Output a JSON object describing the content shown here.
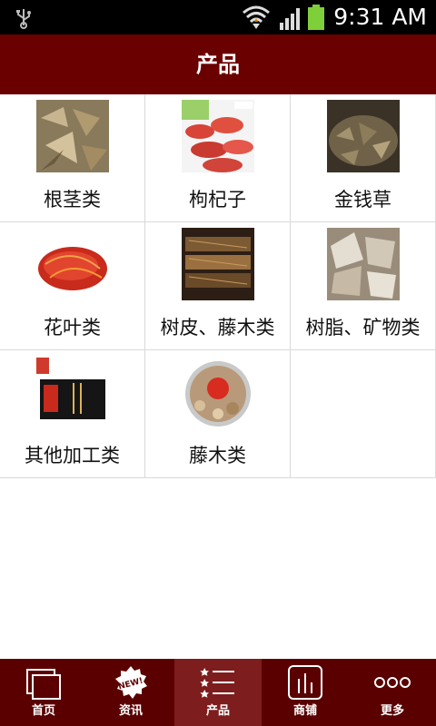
{
  "status_bar": {
    "time": "9:31 AM"
  },
  "header": {
    "title": "产品"
  },
  "categories": [
    {
      "label": "根茎类",
      "icon": "dried-root-slices-image"
    },
    {
      "label": "枸杞子",
      "icon": "goji-berries-image"
    },
    {
      "label": "金钱草",
      "icon": "dried-herb-image"
    },
    {
      "label": "花叶类",
      "icon": "saffron-threads-image"
    },
    {
      "label": "树皮、藤木类",
      "icon": "bark-strips-image"
    },
    {
      "label": "树脂、矿物类",
      "icon": "mineral-chunks-image"
    },
    {
      "label": "其他加工类",
      "icon": "product-box-image"
    },
    {
      "label": "藤木类",
      "icon": "sliced-herb-jar-image"
    }
  ],
  "tabbar": {
    "items": [
      {
        "label": "首页",
        "icon": "home-icon"
      },
      {
        "label": "资讯",
        "icon": "news-badge-icon",
        "badge": "NEW!"
      },
      {
        "label": "产品",
        "icon": "list-icon",
        "active": true
      },
      {
        "label": "商铺",
        "icon": "shop-chart-icon"
      },
      {
        "label": "更多",
        "icon": "more-dots-icon"
      }
    ]
  },
  "colors": {
    "header_bg": "#6b0000",
    "tabbar_bg": "#5a0000",
    "tab_active_bg": "#7e1d1d"
  }
}
